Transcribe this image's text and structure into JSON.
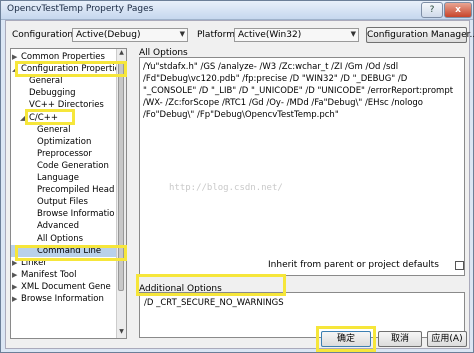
{
  "window": {
    "title": "OpencvTestTemp Property Pages",
    "help_label": "?",
    "close_label": "x"
  },
  "top_bar": {
    "configuration_label": "Configuration:",
    "configuration_value": "Active(Debug)",
    "platform_label": "Platform:",
    "platform_value": "Active(Win32)",
    "config_manager_label": "Configuration Manager..."
  },
  "tree": {
    "items": [
      {
        "label": "Common Properties",
        "twisty": "▶"
      },
      {
        "label": "Configuration Properties",
        "twisty": "◢"
      },
      {
        "label": "General",
        "twisty": ""
      },
      {
        "label": "Debugging",
        "twisty": ""
      },
      {
        "label": "VC++ Directories",
        "twisty": ""
      },
      {
        "label": "C/C++",
        "twisty": "◢"
      },
      {
        "label": "General",
        "twisty": ""
      },
      {
        "label": "Optimization",
        "twisty": ""
      },
      {
        "label": "Preprocessor",
        "twisty": ""
      },
      {
        "label": "Code Generation",
        "twisty": ""
      },
      {
        "label": "Language",
        "twisty": ""
      },
      {
        "label": "Precompiled Head",
        "twisty": ""
      },
      {
        "label": "Output Files",
        "twisty": ""
      },
      {
        "label": "Browse Informatio",
        "twisty": ""
      },
      {
        "label": "Advanced",
        "twisty": ""
      },
      {
        "label": "All Options",
        "twisty": ""
      },
      {
        "label": "Command Line",
        "twisty": ""
      },
      {
        "label": "Linker",
        "twisty": "▶"
      },
      {
        "label": "Manifest Tool",
        "twisty": "▶"
      },
      {
        "label": "XML Document Gene",
        "twisty": "▶"
      },
      {
        "label": "Browse Information",
        "twisty": "▶"
      }
    ]
  },
  "all_options": {
    "heading": "All Options",
    "text": "/Yu\"stdafx.h\" /GS /analyze- /W3 /Zc:wchar_t /ZI /Gm /Od /sdl /Fd\"Debug\\vc120.pdb\" /fp:precise /D \"WIN32\" /D \"_DEBUG\" /D \"_CONSOLE\" /D \"_LIB\" /D \"_UNICODE\" /D \"UNICODE\" /errorReport:prompt /WX- /Zc:forScope /RTC1 /Gd /Oy- /MDd /Fa\"Debug\\\" /EHsc /nologo /Fo\"Debug\\\" /Fp\"Debug\\OpencvTestTemp.pch\"",
    "watermark": "http://blog.csdn.net/"
  },
  "additional_options": {
    "heading": "Additional Options",
    "inherit_label": "Inherit from parent or project defaults",
    "value": "/D _CRT_SECURE_NO_WARNINGS"
  },
  "buttons": {
    "ok": "确定",
    "cancel": "取消",
    "apply": "应用(A)"
  },
  "colors": {
    "highlight": "#f6e63a",
    "selection": "#b9d1ea"
  }
}
